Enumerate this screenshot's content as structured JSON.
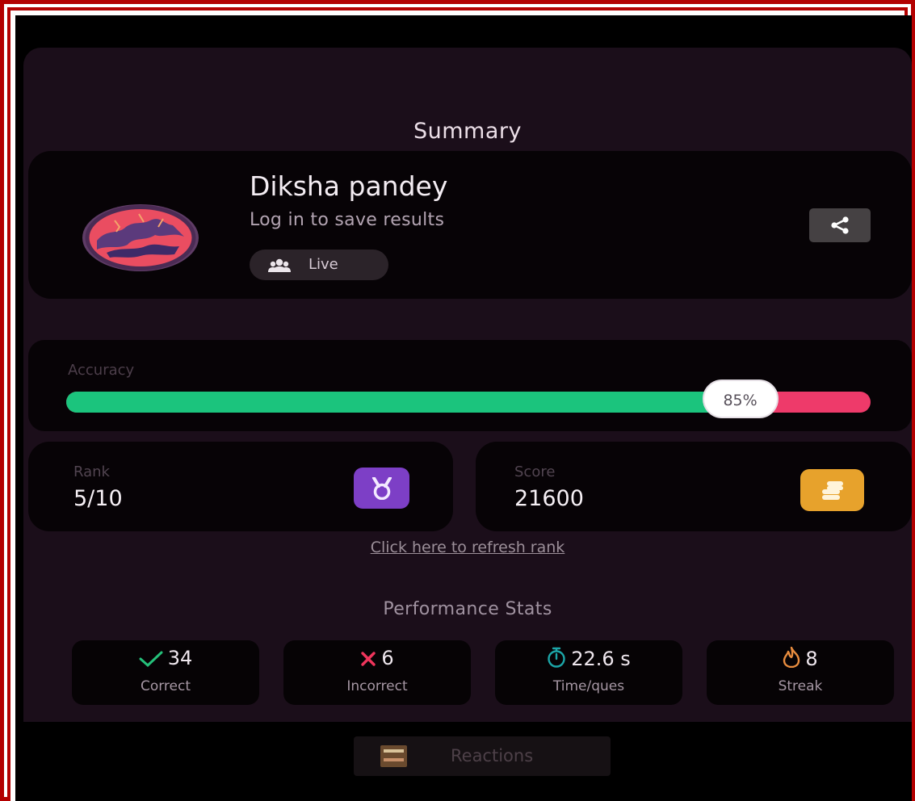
{
  "summary": {
    "title": "Summary"
  },
  "profile": {
    "name": "Diksha pandey",
    "subtitle": "Log in to save results",
    "mode_chip": {
      "icon": "group-icon",
      "label": "Live"
    },
    "share_icon": "share-icon"
  },
  "accuracy": {
    "label": "Accuracy",
    "value_text": "85%",
    "value": 0.85
  },
  "rank": {
    "label": "Rank",
    "value": "5/10",
    "icon": "medal-icon"
  },
  "score": {
    "label": "Score",
    "value": "21600",
    "icon": "coins-icon"
  },
  "refresh_link": "Click here to refresh rank",
  "performance": {
    "title": "Performance Stats",
    "stats": [
      {
        "icon": "check-icon",
        "value": "34",
        "label": "Correct"
      },
      {
        "icon": "cross-icon",
        "value": "6",
        "label": "Incorrect"
      },
      {
        "icon": "stopwatch-icon",
        "value": "22.6 s",
        "label": "Time/ques"
      },
      {
        "icon": "flame-icon",
        "value": "8",
        "label": "Streak"
      }
    ]
  },
  "reactions": {
    "label": "Reactions"
  },
  "colors": {
    "frame": "#b30000",
    "accuracy_fill": "#1bc47d",
    "accuracy_track": "#ee3a6a",
    "rank_badge": "#7d3fc6",
    "score_badge": "#e7a22c",
    "correct": "#25c07a",
    "incorrect": "#f0355c",
    "time": "#1ca6a8",
    "streak": "#e98d3f"
  }
}
